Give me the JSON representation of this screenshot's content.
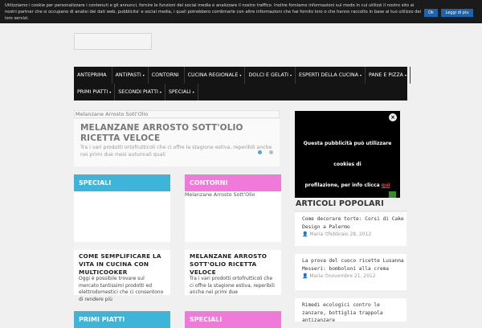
{
  "cookie": {
    "text": "Utilizziamo i cookie per personalizzare i contenuti e gli annunci, fornire le funzioni dei social media e analizzare il nostro traffico. Inoltre forniamo informazioni sul modo in cui utilizzi il nostro sito ai nostri partner che si occupano di analisi dei dati web, pubblicita' e social media, i quali potrebbero combinarle con altre informazioni che hai fornito loro o che hanno raccolto in base al tuo utilizzo dei loro servizi.",
    "ok_label": "Ok",
    "more_label": "Leggi di piu"
  },
  "nav": {
    "row1": [
      {
        "label": "ANTEPRIMA",
        "arrow": ""
      },
      {
        "label": "ANTIPASTI",
        "arrow": "▾"
      },
      {
        "label": "CONTORNI",
        "arrow": ""
      },
      {
        "label": "CUCINA REGIONALE",
        "arrow": "▾"
      },
      {
        "label": "DOLCI E GELATI",
        "arrow": "▾"
      },
      {
        "label": "ESPERTI DELLA CUCINA",
        "arrow": "▾"
      },
      {
        "label": "PANE E PIZZA",
        "arrow": "▾"
      }
    ],
    "row2": [
      {
        "label": "PRIMI PIATTI",
        "arrow": "▾"
      },
      {
        "label": "SECONDI PIATTI",
        "arrow": "▾"
      },
      {
        "label": "SPECIALI",
        "arrow": "▾"
      }
    ]
  },
  "breadcrumb": "Melanzane Arrosto Sott'Olio",
  "hero": {
    "title": "MELANZANE ARROSTO SOTT'OLIO RICETTA VELOCE",
    "text": "Tra i vari prodotti ortofrutticoli che ci offre la stagione estiva, reperibili anche nei primi due mesi autunnali quali"
  },
  "cards": [
    {
      "head": "SPECIALI",
      "color": "#3fb4d9",
      "title": "COME SEMPLIFICARE LA VITA IN CUCINA CON MULTICOOKER",
      "text": "Oggi è possibile trovare sul mercato tantissimi prodotti ed elettrodomestici che ci consentono di rendere più"
    },
    {
      "head": "CONTORNI",
      "color": "#f07ad9",
      "caption": "Melanzane Arrosto Sott'Olio",
      "title": "MELANZANE ARROSTO SOTT'OLIO RICETTA VELOCE",
      "text": "Tra i vari prodotti ortofrutticoli che ci offre la stagione estiva, reperibili anche nei primi due"
    },
    {
      "head": "PRIMI PIATTI",
      "color": "#3fb4d9"
    },
    {
      "head": "SPECIALI",
      "color": "#f07ad9"
    }
  ],
  "ad": {
    "line1": "Questa pubblicità può utilizzare cookies di",
    "line2_pre": "profilazione, per info clicca ",
    "line2_link": "qui",
    "close": "×"
  },
  "popular": {
    "title": "ARTICOLI POPOLARI",
    "items": [
      {
        "title": "Come decorare torte: Corsi di Cake Design a Palermo",
        "author": "Maria",
        "date": "febbraio 28, 2012"
      },
      {
        "title": "La prova del cuoco ricette Lusanna Messeri: bomboloni alla crema",
        "author": "Maria",
        "date": "novembre 21, 2012"
      },
      {
        "title": "Rimedi ecologici contro le zanzare, bottiglia trappola antizanzare",
        "author": "",
        "date": ""
      }
    ]
  }
}
